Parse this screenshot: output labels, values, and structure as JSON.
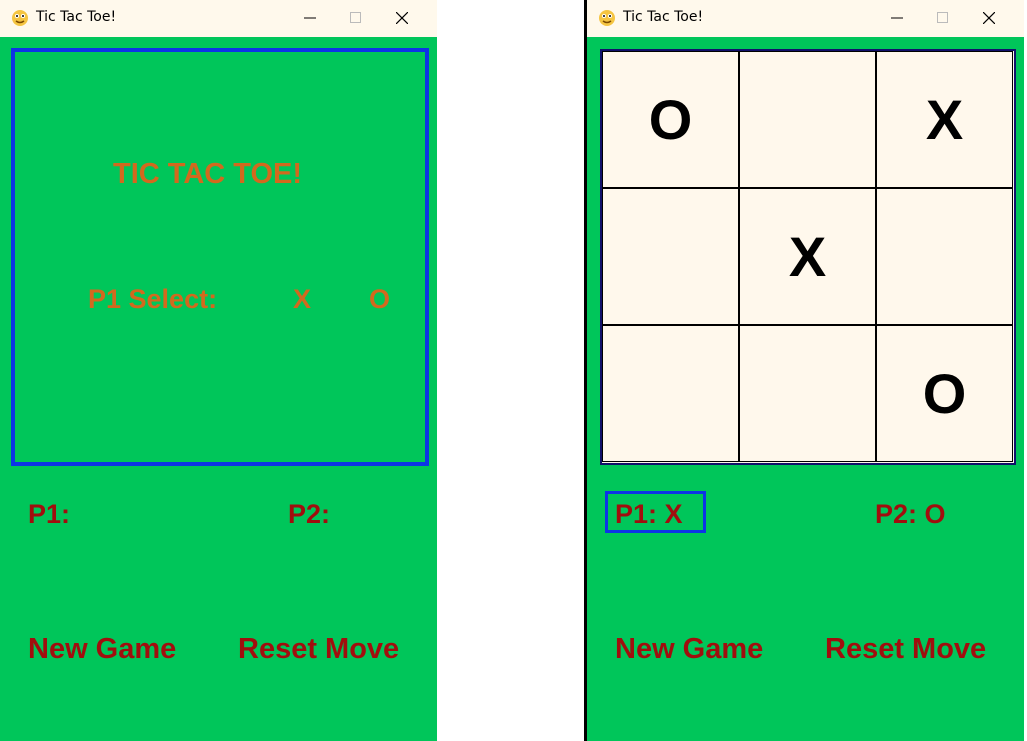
{
  "left_window": {
    "title": "Tic Tac Toe!",
    "menu": {
      "heading": "TIC TAC TOE!",
      "select_label": "P1 Select:",
      "option_x": "X",
      "option_o": "O"
    },
    "p1_label": "P1:",
    "p2_label": "P2:",
    "new_game": "New Game",
    "reset_move": "Reset Move"
  },
  "right_window": {
    "title": "Tic Tac Toe!",
    "board": [
      [
        "O",
        "",
        "X"
      ],
      [
        "",
        "X",
        ""
      ],
      [
        "",
        "",
        "O"
      ]
    ],
    "p1_label": "P1: X",
    "p2_label": "P2: O",
    "new_game": "New Game",
    "reset_move": "Reset Move"
  },
  "colors": {
    "background": "#00c65a",
    "border_blue": "#0d34e6",
    "orange_text": "#d2691e",
    "dark_red_text": "#a10e0e",
    "board_bg": "#fff8ec",
    "titlebar": "#fff9ec"
  },
  "icons": {
    "app": "python-snake-icon",
    "minimize": "minimize-icon",
    "maximize": "maximize-icon",
    "close": "close-icon"
  }
}
